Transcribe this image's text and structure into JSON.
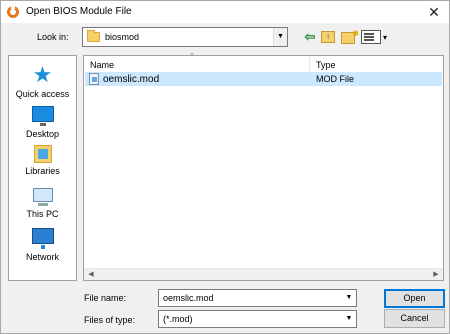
{
  "window": {
    "title": "Open BIOS Module File",
    "close_glyph": "✕"
  },
  "lookin": {
    "label": "Look in:",
    "value": "biosmod"
  },
  "places": [
    {
      "label": "Quick access",
      "icon": "quick-access-star-icon"
    },
    {
      "label": "Desktop",
      "icon": "desktop-icon"
    },
    {
      "label": "Libraries",
      "icon": "libraries-icon"
    },
    {
      "label": "This PC",
      "icon": "this-pc-icon"
    },
    {
      "label": "Network",
      "icon": "network-icon"
    }
  ],
  "filelist": {
    "columns": {
      "name": "Name",
      "type": "Type"
    },
    "rows": [
      {
        "name": "oemslic.mod",
        "type": "MOD File",
        "selected": true
      }
    ]
  },
  "bottom": {
    "filename_label": "File name:",
    "filename_value": "oemslic.mod",
    "filetype_label": "Files of type:",
    "filetype_value": "(*.mod)",
    "open_label": "Open",
    "cancel_label": "Cancel"
  },
  "colors": {
    "selection": "#cce8ff",
    "accent": "#0078d7",
    "app_icon": "#e8781c"
  }
}
